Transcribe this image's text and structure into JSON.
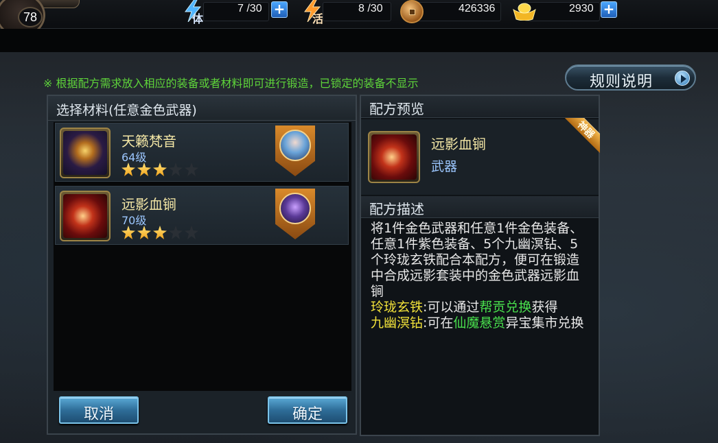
{
  "topbar": {
    "level": "78",
    "stamina": {
      "icon_label": "体",
      "value": "7 /30"
    },
    "vitality": {
      "icon_label": "活",
      "value": "8 /30"
    },
    "copper": {
      "value": "426336"
    },
    "gold": {
      "value": "2930"
    }
  },
  "hint": "※ 根据配方需求放入相应的装备或者材料即可进行锻造，已锁定的装备不显示",
  "rules_button": "规则说明",
  "left_panel": {
    "title": "选择材料(任意金色武器)",
    "items": [
      {
        "name": "天籁梵音",
        "level": "64级",
        "stars": 3,
        "max_stars": 5,
        "icon": "golden-wand-icon",
        "hero": "blue-hair-hero-icon"
      },
      {
        "name": "远影血锏",
        "level": "70级",
        "stars": 3,
        "max_stars": 5,
        "icon": "blood-mace-icon",
        "hero": "purple-demon-hero-icon"
      }
    ],
    "cancel": "取消",
    "confirm": "确定"
  },
  "right_panel": {
    "preview_title": "配方预览",
    "item_name": "远影血锏",
    "item_type": "武器",
    "ribbon": "神器",
    "desc_title": "配方描述",
    "desc_main": "将1件金色武器和任意1件金色装备、任意1件紫色装备、5个九幽溟钻、5个玲珑玄铁配合本配方，便可在锻造中合成远影套装中的金色武器远影血锏",
    "desc_line1_a": "玲珑玄铁",
    "desc_line1_b": ":可以通过",
    "desc_line1_c": "帮贡兑换",
    "desc_line1_d": "获得",
    "desc_line2_a": "九幽溟钻",
    "desc_line2_b": ":可在",
    "desc_line2_c": "仙魔悬赏",
    "desc_line2_d": "异宝集市兑换"
  },
  "colors": {
    "hint_green": "#5ed43a",
    "highlight_yellow": "#f2e23a",
    "highlight_green": "#49e04d",
    "item_name": "#f3e6a5",
    "level_blue": "#9cc7ff"
  }
}
